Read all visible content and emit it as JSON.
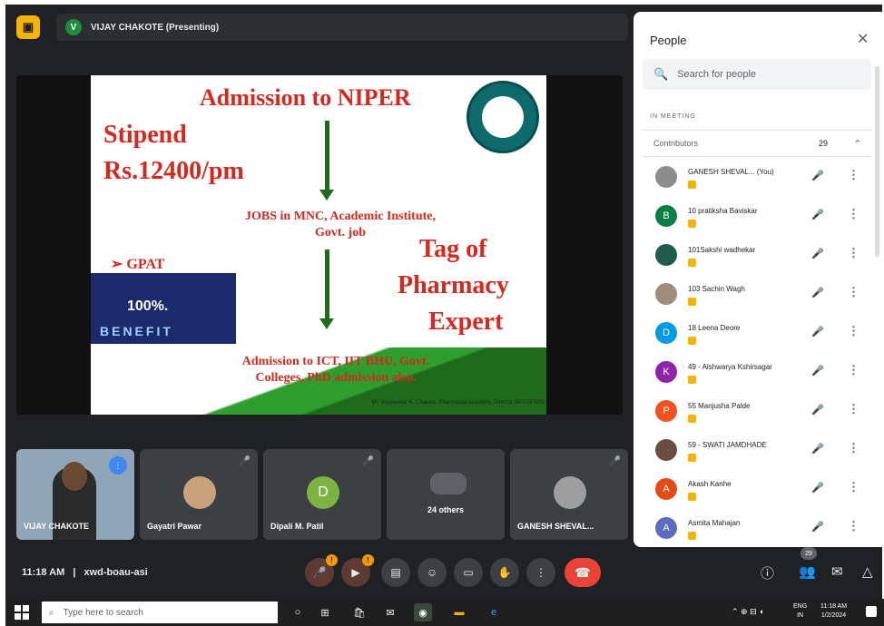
{
  "presenter": {
    "initial": "V",
    "label": "VIJAY CHAKOTE (Presenting)"
  },
  "slide": {
    "title": "Admission to NIPER",
    "stipend_line1": "Stipend",
    "stipend_line2": "Rs.12400/pm",
    "jobs_line1": "JOBS in MNC, Academic Institute,",
    "jobs_line2": "Govt. job",
    "gpat": "➢ GPAT",
    "tag_line1": "Tag of",
    "tag_line2": "Pharmacy",
    "tag_line3": "Expert",
    "admission_line1": "Admission to ICT, IIT BHU, Govt.",
    "admission_line2": "Colleges, PhD admission also.",
    "benefit_percent": "100%.",
    "benefit_word": "BENEFIT",
    "footer": "Mr. Vijaykumar K. Chakote. Pharmastar Academy, Director 9970767652"
  },
  "tiles": [
    {
      "name": "VIJAY CHAKOTE",
      "type": "self"
    },
    {
      "name": "Gayatri Pawar",
      "type": "avatar",
      "color": "#c8a27a"
    },
    {
      "name": "Dipali M. Patil",
      "type": "initial",
      "initial": "D",
      "color": "#7cb342"
    },
    {
      "name": "24 others",
      "type": "group"
    },
    {
      "name": "GANESH SHEVAL...",
      "type": "avatar",
      "color": "#9e9e9e"
    }
  ],
  "panel": {
    "title": "People",
    "search_placeholder": "Search for people",
    "section": "IN MEETING",
    "contributors_label": "Contributors",
    "contributors_count": "29",
    "people": [
      {
        "name": "GANESH SHEVAL...   (You)",
        "initial": "",
        "color": "#8d8d8d"
      },
      {
        "name": "10 pratiksha Baviskar",
        "initial": "B",
        "color": "#0b8043"
      },
      {
        "name": "101Sakshi wadhekar",
        "initial": "",
        "color": "#1e5d4b"
      },
      {
        "name": "103 Sachin Wagh",
        "initial": "",
        "color": "#9e8b7a"
      },
      {
        "name": "18 Leena Deore",
        "initial": "D",
        "color": "#039be5"
      },
      {
        "name": "49 - Aishwarya Kshirsagar",
        "initial": "K",
        "color": "#8e24aa"
      },
      {
        "name": "55 Manjusha Palde",
        "initial": "P",
        "color": "#f4511e"
      },
      {
        "name": "59 - SWATI JAMDHADE",
        "initial": "",
        "color": "#6d4c41"
      },
      {
        "name": "Akash Kanhe",
        "initial": "A",
        "color": "#e64a19"
      },
      {
        "name": "Asmita Mahajan",
        "initial": "A",
        "color": "#5c6bc0"
      }
    ]
  },
  "bottom": {
    "time": "11:18 AM",
    "separator": "|",
    "code": "xwd-boau-asi",
    "participant_badge": "29"
  },
  "taskbar": {
    "search_placeholder": "Type here to search",
    "lang1": "ENG",
    "lang2": "IN",
    "time": "11:18 AM",
    "date": "1/2/2024"
  }
}
